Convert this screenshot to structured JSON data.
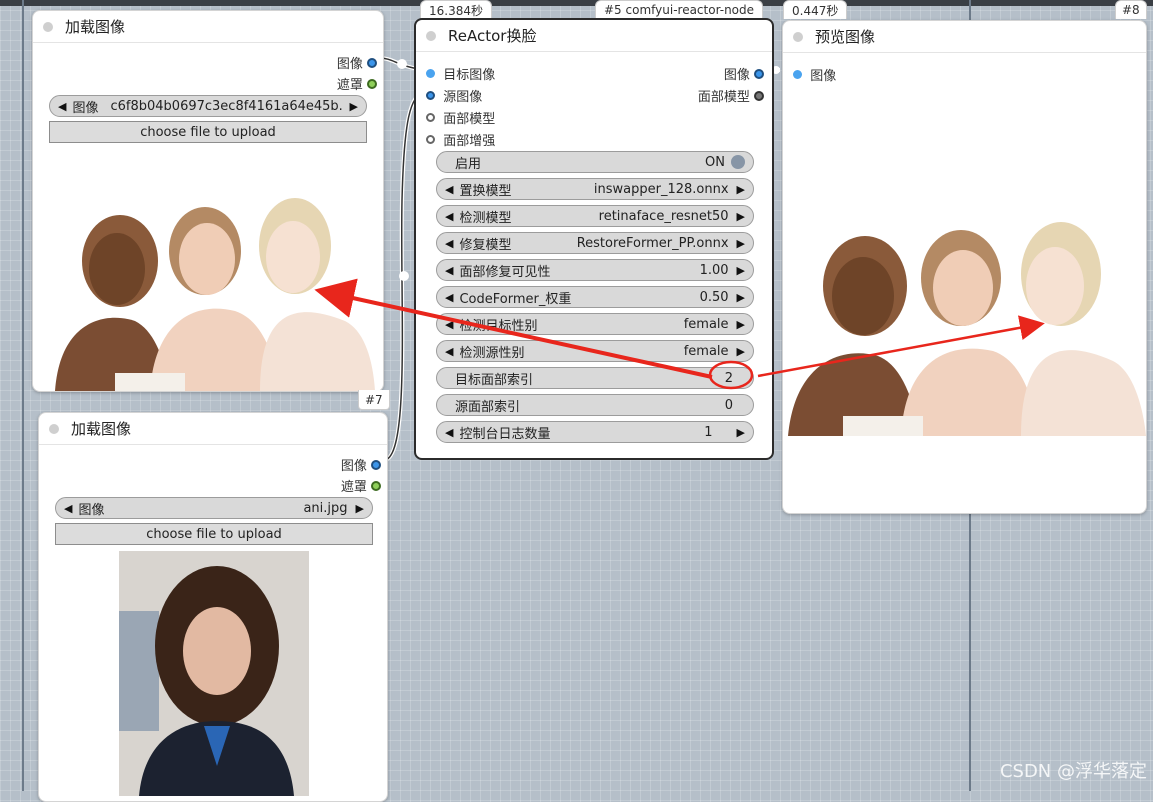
{
  "nodes": {
    "load1": {
      "title": "加载图像",
      "outputs": {
        "image": "图像",
        "mask": "遮罩"
      },
      "image_widget": {
        "label": "图像",
        "value": "c6f8b04b0697c3ec8f4161a64e45b..."
      },
      "upload": "choose file to upload",
      "badge": "#7"
    },
    "load2": {
      "title": "加载图像",
      "outputs": {
        "image": "图像",
        "mask": "遮罩"
      },
      "image_widget": {
        "label": "图像",
        "value": "ani.jpg"
      },
      "upload": "choose file to upload"
    },
    "reactor": {
      "title": "ReActor换脸",
      "timing": "16.384秒",
      "badge": "#5 comfyui-reactor-node",
      "inputs": [
        "目标图像",
        "源图像",
        "面部模型",
        "面部增强"
      ],
      "outputs": {
        "image": "图像",
        "face_model": "面部模型"
      },
      "widgets": [
        {
          "label": "启用",
          "value": "ON",
          "type": "toggle"
        },
        {
          "label": "置换模型",
          "value": "inswapper_128.onnx",
          "type": "combo"
        },
        {
          "label": "检测模型",
          "value": "retinaface_resnet50",
          "type": "combo"
        },
        {
          "label": "修复模型",
          "value": "RestoreFormer_PP.onnx",
          "type": "combo"
        },
        {
          "label": "面部修复可见性",
          "value": "1.00",
          "type": "number"
        },
        {
          "label": "CodeFormer_权重",
          "value": "0.50",
          "type": "number"
        },
        {
          "label": "检测目标性别",
          "value": "female",
          "type": "combo"
        },
        {
          "label": "检测源性别",
          "value": "female",
          "type": "combo"
        },
        {
          "label": "目标面部索引",
          "value": "2",
          "type": "text"
        },
        {
          "label": "源面部索引",
          "value": "0",
          "type": "text"
        },
        {
          "label": "控制台日志数量",
          "value": "1",
          "type": "number"
        }
      ]
    },
    "preview": {
      "title": "预览图像",
      "timing": "0.447秒",
      "badge": "#8",
      "inputs": [
        "图像"
      ]
    }
  },
  "watermark": "CSDN @浮华落定",
  "colors": {
    "annotation": "#e8261c",
    "socket_image": "#3b95ea",
    "socket_mask": "#8fcf5a"
  }
}
